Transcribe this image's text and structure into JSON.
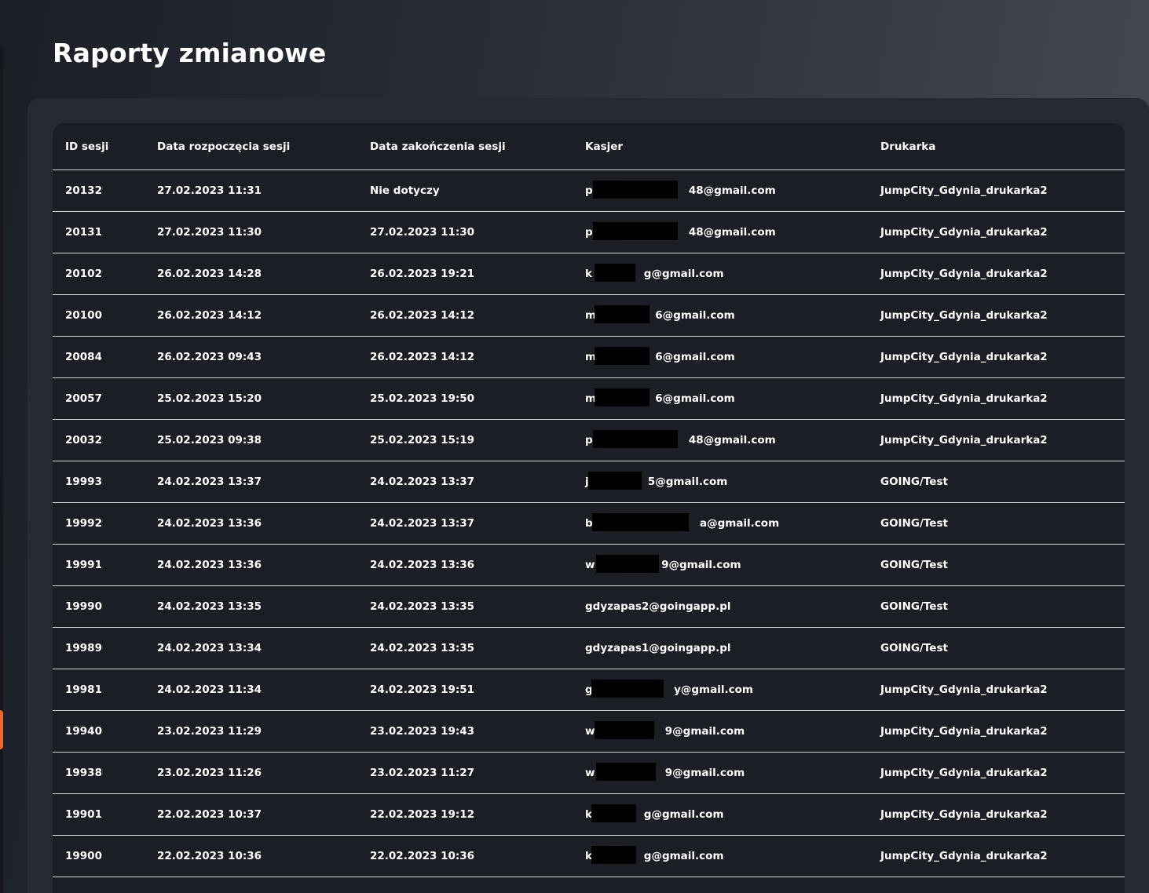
{
  "page": {
    "title": "Raporty zmianowe"
  },
  "table": {
    "columns": [
      "ID sesji",
      "Data rozpoczęcia sesji",
      "Data zakończenia sesji",
      "Kasjer",
      "Drukarka"
    ],
    "rows": [
      {
        "id": "20132",
        "start": "27.02.2023 11:31",
        "end": "Nie dotyczy",
        "cashier": "p                          48@gmail.com",
        "printer": "JumpCity_Gdynia_drukarka2"
      },
      {
        "id": "20131",
        "start": "27.02.2023 11:30",
        "end": "27.02.2023 11:30",
        "cashier": "p                          48@gmail.com",
        "printer": "JumpCity_Gdynia_drukarka2"
      },
      {
        "id": "20102",
        "start": "26.02.2023 14:28",
        "end": "26.02.2023 19:21",
        "cashier": "k              g@gmail.com",
        "printer": "JumpCity_Gdynia_drukarka2"
      },
      {
        "id": "20100",
        "start": "26.02.2023 14:12",
        "end": "26.02.2023 14:12",
        "cashier": "m                6@gmail.com",
        "printer": "JumpCity_Gdynia_drukarka2"
      },
      {
        "id": "20084",
        "start": "26.02.2023 09:43",
        "end": "26.02.2023 14:12",
        "cashier": "m                6@gmail.com",
        "printer": "JumpCity_Gdynia_drukarka2"
      },
      {
        "id": "20057",
        "start": "25.02.2023 15:20",
        "end": "25.02.2023 19:50",
        "cashier": "m                6@gmail.com",
        "printer": "JumpCity_Gdynia_drukarka2"
      },
      {
        "id": "20032",
        "start": "25.02.2023 09:38",
        "end": "25.02.2023 15:19",
        "cashier": "p                          48@gmail.com",
        "printer": "JumpCity_Gdynia_drukarka2"
      },
      {
        "id": "19993",
        "start": "24.02.2023 13:37",
        "end": "24.02.2023 13:37",
        "cashier": "j                5@gmail.com",
        "printer": "GOING/Test"
      },
      {
        "id": "19992",
        "start": "24.02.2023 13:36",
        "end": "24.02.2023 13:37",
        "cashier": "b                             a@gmail.com",
        "printer": "GOING/Test"
      },
      {
        "id": "19991",
        "start": "24.02.2023 13:36",
        "end": "24.02.2023 13:36",
        "cashier": "w                  9@gmail.com",
        "printer": "GOING/Test"
      },
      {
        "id": "19990",
        "start": "24.02.2023 13:35",
        "end": "24.02.2023 13:35",
        "cashier": "gdyzapas2@goingapp.pl",
        "printer": "GOING/Test"
      },
      {
        "id": "19989",
        "start": "24.02.2023 13:34",
        "end": "24.02.2023 13:35",
        "cashier": "gdyzapas1@goingapp.pl",
        "printer": "GOING/Test"
      },
      {
        "id": "19981",
        "start": "24.02.2023 11:34",
        "end": "24.02.2023 19:51",
        "cashier": "g                      y@gmail.com",
        "printer": "JumpCity_Gdynia_drukarka2"
      },
      {
        "id": "19940",
        "start": "23.02.2023 11:29",
        "end": "23.02.2023 19:43",
        "cashier": "w                   9@gmail.com",
        "printer": "JumpCity_Gdynia_drukarka2"
      },
      {
        "id": "19938",
        "start": "23.02.2023 11:26",
        "end": "23.02.2023 11:27",
        "cashier": "w                   9@gmail.com",
        "printer": "JumpCity_Gdynia_drukarka2"
      },
      {
        "id": "19901",
        "start": "22.02.2023 10:37",
        "end": "22.02.2023 19:12",
        "cashier": "k              g@gmail.com",
        "printer": "JumpCity_Gdynia_drukarka2"
      },
      {
        "id": "19900",
        "start": "22.02.2023 10:36",
        "end": "22.02.2023 10:36",
        "cashier": "k              g@gmail.com",
        "printer": "JumpCity_Gdynia_drukarka2"
      }
    ]
  },
  "colors": {
    "accent": "#f26a2b",
    "panel": "#262a33",
    "table": "#1b1e25",
    "divider": "#d8d8d8",
    "text": "#ffffff"
  }
}
